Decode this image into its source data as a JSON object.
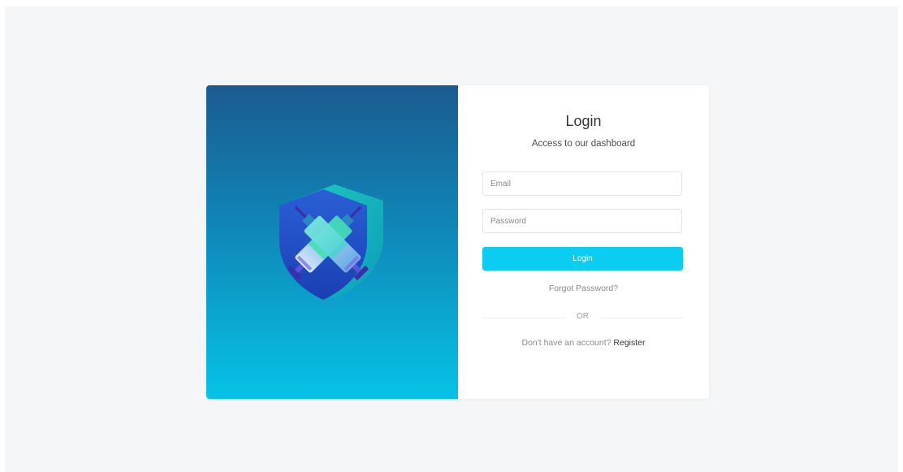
{
  "login": {
    "title": "Login",
    "subtitle": "Access to our dashboard",
    "email_placeholder": "Email",
    "password_placeholder": "Password",
    "login_button": "Login",
    "forgot_password": "Forgot Password?",
    "divider": "OR",
    "no_account_text": "Don't have an account?",
    "register_link": "Register"
  },
  "colors": {
    "page_background": "#f4f6f8",
    "gradient_top": "#1b5b8f",
    "gradient_bottom": "#06c3e6",
    "accent": "#0bcdf1",
    "title_text": "#333333",
    "muted_text": "#8a8a8a"
  },
  "icons": {
    "logo": "crossed-syringes-shield-icon"
  }
}
